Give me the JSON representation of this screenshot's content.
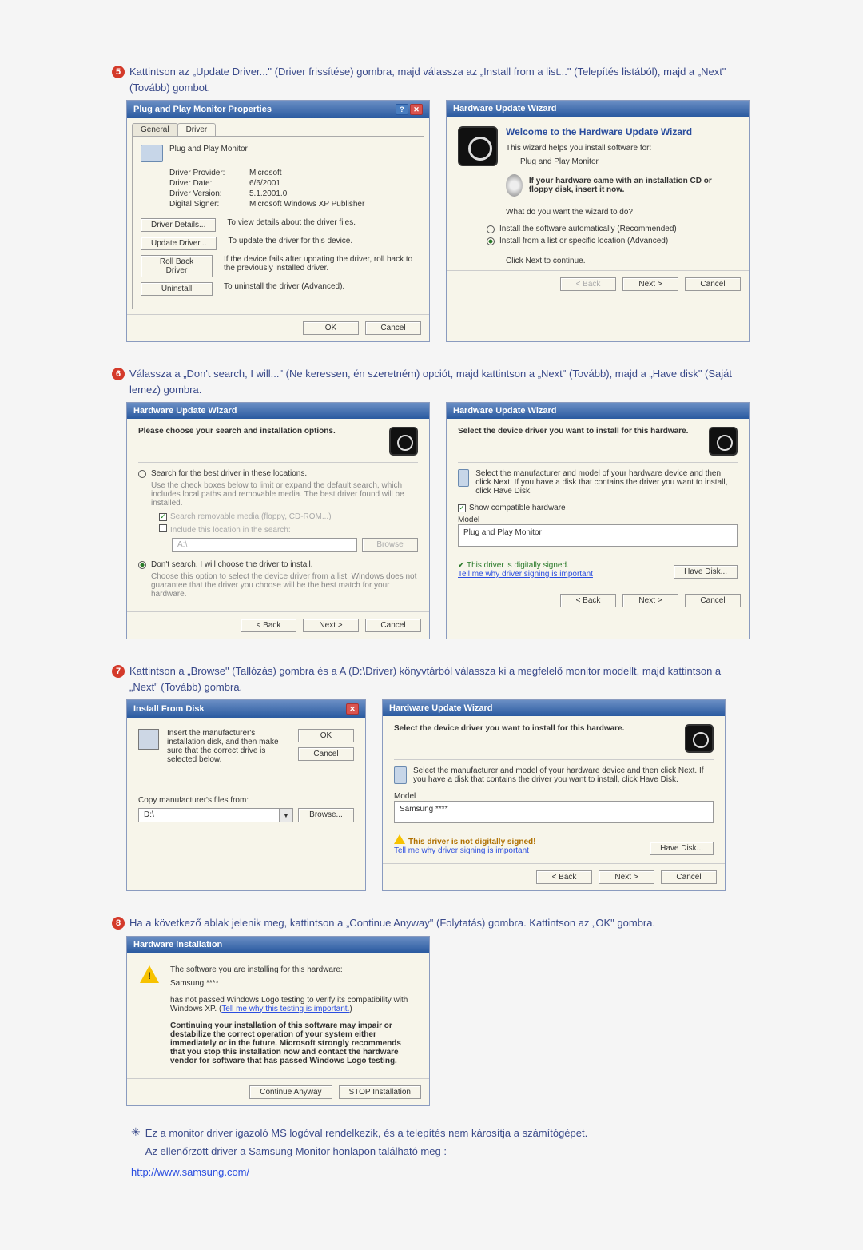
{
  "step5": {
    "num": "5",
    "text": "Kattintson az „Update Driver...\" (Driver frissítése) gombra, majd válassza az „Install from a list...\" (Telepítés listából), majd a „Next\" (Tovább) gombot.",
    "dlg1": {
      "title": "Plug and Play Monitor Properties",
      "tab_general": "General",
      "tab_driver": "Driver",
      "device_name": "Plug and Play Monitor",
      "prov_k": "Driver Provider:",
      "prov_v": "Microsoft",
      "date_k": "Driver Date:",
      "date_v": "6/6/2001",
      "ver_k": "Driver Version:",
      "ver_v": "5.1.2001.0",
      "sign_k": "Digital Signer:",
      "sign_v": "Microsoft Windows XP Publisher",
      "btn_details": "Driver Details...",
      "btn_details_d": "To view details about the driver files.",
      "btn_update": "Update Driver...",
      "btn_update_d": "To update the driver for this device.",
      "btn_roll": "Roll Back Driver",
      "btn_roll_d": "If the device fails after updating the driver, roll back to the previously installed driver.",
      "btn_uninst": "Uninstall",
      "btn_uninst_d": "To uninstall the driver (Advanced).",
      "ok": "OK",
      "cancel": "Cancel"
    },
    "dlg2": {
      "title": "Hardware Update Wizard",
      "welcome": "Welcome to the Hardware Update Wizard",
      "intro1": "This wizard helps you install software for:",
      "device": "Plug and Play Monitor",
      "cd_note": "If your hardware came with an installation CD or floppy disk, insert it now.",
      "q": "What do you want the wizard to do?",
      "opt1": "Install the software automatically (Recommended)",
      "opt2": "Install from a list or specific location (Advanced)",
      "cont": "Click Next to continue.",
      "back": "< Back",
      "next": "Next >",
      "cancel": "Cancel"
    }
  },
  "step6": {
    "num": "6",
    "text": "Válassza a „Don't search, I will...\" (Ne keressen, én szeretném) opciót, majd kattintson a „Next\" (Tovább), majd a „Have disk\" (Saját lemez) gombra.",
    "dlg1": {
      "title": "Hardware Update Wizard",
      "hdr": "Please choose your search and installation options.",
      "opt1": "Search for the best driver in these locations.",
      "opt1d": "Use the check boxes below to limit or expand the default search, which includes local paths and removable media. The best driver found will be installed.",
      "c1": "Search removable media (floppy, CD-ROM...)",
      "c2": "Include this location in the search:",
      "path": "A:\\",
      "browse": "Browse",
      "opt2": "Don't search. I will choose the driver to install.",
      "opt2d": "Choose this option to select the device driver from a list. Windows does not guarantee that the driver you choose will be the best match for your hardware.",
      "back": "< Back",
      "next": "Next >",
      "cancel": "Cancel"
    },
    "dlg2": {
      "title": "Hardware Update Wizard",
      "hdr": "Select the device driver you want to install for this hardware.",
      "instr": "Select the manufacturer and model of your hardware device and then click Next. If you have a disk that contains the driver you want to install, click Have Disk.",
      "compat": "Show compatible hardware",
      "model_lbl": "Model",
      "model_val": "Plug and Play Monitor",
      "signed": "This driver is digitally signed.",
      "why": "Tell me why driver signing is important",
      "have": "Have Disk...",
      "back": "< Back",
      "next": "Next >",
      "cancel": "Cancel"
    }
  },
  "step7": {
    "num": "7",
    "text": "Kattintson a „Browse\" (Tallózás) gombra és a A (D:\\Driver) könyvtárból válassza ki a megfelelő monitor modellt, majd kattintson a „Next\" (Tovább) gombra.",
    "dlg1": {
      "title": "Install From Disk",
      "instr": "Insert the manufacturer's installation disk, and then make sure that the correct drive is selected below.",
      "ok": "OK",
      "cancel": "Cancel",
      "copy": "Copy manufacturer's files from:",
      "path": "D:\\",
      "browse": "Browse..."
    },
    "dlg2": {
      "title": "Hardware Update Wizard",
      "hdr": "Select the device driver you want to install for this hardware.",
      "instr": "Select the manufacturer and model of your hardware device and then click Next. If you have a disk that contains the driver you want to install, click Have Disk.",
      "model_lbl": "Model",
      "model_val": "Samsung ****",
      "unsigned": "This driver is not digitally signed!",
      "why": "Tell me why driver signing is important",
      "have": "Have Disk...",
      "back": "< Back",
      "next": "Next >",
      "cancel": "Cancel"
    }
  },
  "step8": {
    "num": "8",
    "text": "Ha a következő ablak jelenik meg, kattintson a „Continue Anyway\" (Folytatás) gombra. Kattintson az „OK\" gombra.",
    "dlg": {
      "title": "Hardware Installation",
      "l1": "The software you are installing for this hardware:",
      "l2": "Samsung ****",
      "l3": "has not passed Windows Logo testing to verify its compatibility with Windows XP. (",
      "l3link": "Tell me why this testing is important.",
      "l3end": ")",
      "l4": "Continuing your installation of this software may impair or destabilize the correct operation of your system either immediately or in the future. Microsoft strongly recommends that you stop this installation now and contact the hardware vendor for software that has passed Windows Logo testing.",
      "cont": "Continue Anyway",
      "stop": "STOP Installation"
    }
  },
  "footnote": {
    "l1": "Ez a monitor driver igazoló MS logóval rendelkezik, és a telepítés nem károsítja a számítógépet.",
    "l2": "Az ellenőrzött driver a Samsung Monitor honlapon található meg :",
    "url": "http://www.samsung.com/"
  }
}
